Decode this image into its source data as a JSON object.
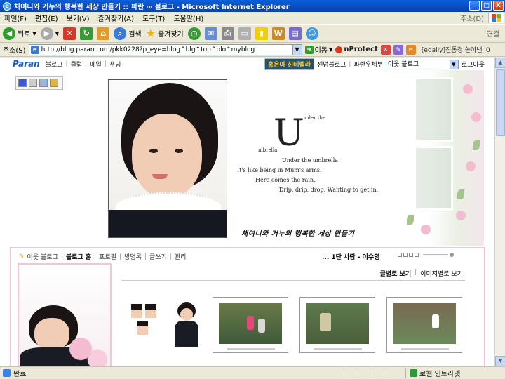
{
  "window": {
    "title": "채여니와 거누의 행복한 세상 만들기 :: 파란 ∞ 블로그 - Microsoft Internet Explorer",
    "buttons": [
      "_",
      "□",
      "X"
    ]
  },
  "menu": {
    "items": [
      "파일(F)",
      "편집(E)",
      "보기(V)",
      "즐겨찾기(A)",
      "도구(T)",
      "도움말(H)"
    ],
    "address_shortcut": "주소(D)"
  },
  "toolbar": {
    "back": "뒤로",
    "search": "검색",
    "favorites": "즐겨찾기",
    "connect": "연결"
  },
  "address": {
    "label": "주소(S)",
    "url": "http://blog.paran.com/pkk0228?p_eye=blog^blg^top^blo^myblog",
    "go": "이동",
    "nprotect": "nProtect",
    "news": "[edaily]진동경 쏟아낸 '0"
  },
  "paran": {
    "logo": "Paran",
    "nav": [
      "블로그",
      "클럽",
      "메일",
      "푸딩"
    ],
    "promo": "홍은아 신데렐라",
    "links": [
      "젠덤블로그",
      "파란우체부"
    ],
    "select_value": "이웃 블로그",
    "logout": "로그아웃"
  },
  "poem": {
    "big_letter": "U",
    "line1": "nder the",
    "line2": "mbrella",
    "line3": "Under the umbrella",
    "line4": "It's like being in Mum's arms.",
    "line5": "Here comes the rain.",
    "line6": "Drip, drip, drop. Wanting to get in."
  },
  "blog_title": "채여니와 거누의 행복한 세상 만들기",
  "lower_nav": {
    "items": [
      "이웃 블로그",
      "블로그 홈",
      "프로필",
      "방명록",
      "글쓰기",
      "관리"
    ],
    "now_playing": "... 1단 사람 - 이수영"
  },
  "view_tabs": {
    "text_view": "글별로 보기",
    "image_view": "이미지별로 보기"
  },
  "status": {
    "text": "완료",
    "zone": "로컬 인트라넷"
  }
}
